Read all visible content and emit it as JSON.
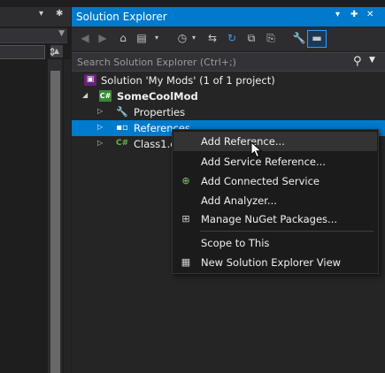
{
  "left_panel": {
    "dropdown_glyph": "▾",
    "gear_glyph": "✱"
  },
  "solution_explorer": {
    "title": "Solution Explorer",
    "title_controls": [
      "▾",
      "✚",
      "✕"
    ],
    "search": {
      "placeholder": "Search Solution Explorer (Ctrl+;)"
    },
    "toolbar_icons": [
      "back-icon",
      "forward-icon",
      "home-icon",
      "sync-view-icon",
      "pending-changes-icon",
      "switch-views-icon",
      "refresh-icon",
      "collapse-all-icon",
      "show-all-files-icon",
      "properties-icon",
      "preview-selected-icon"
    ],
    "tree": {
      "solution": "Solution 'My Mods' (1 of 1 project)",
      "project": "SomeCoolMod",
      "properties": "Properties",
      "references": "References",
      "class_file": "Class1.cs"
    }
  },
  "context_menu": {
    "items": [
      {
        "label": "Add Reference...",
        "icon": ""
      },
      {
        "label": "Add Service Reference...",
        "icon": ""
      },
      {
        "label": "Add Connected Service",
        "icon": "connected-service-icon"
      },
      {
        "label": "Add Analyzer...",
        "icon": ""
      },
      {
        "label": "Manage NuGet Packages...",
        "icon": "nuget-icon"
      },
      {
        "label": "Scope to This",
        "icon": ""
      },
      {
        "label": "New Solution Explorer View",
        "icon": "new-view-icon"
      }
    ]
  },
  "colors": {
    "accent": "#007acc",
    "background": "#252526",
    "menu_background": "#1b1b1c",
    "text": "#f1f1f1"
  }
}
